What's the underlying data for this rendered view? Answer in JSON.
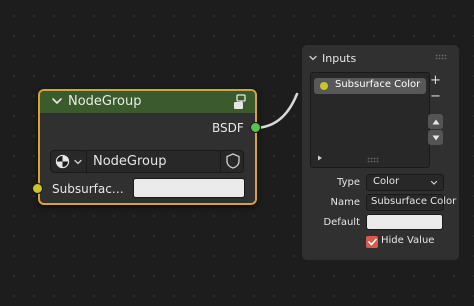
{
  "node": {
    "title": "NodeGroup",
    "output_socket": "BSDF",
    "group_name": "NodeGroup",
    "input_socket": "Subsurfac…",
    "header_color": "#3b5b2d",
    "selected_outline_color": "#d6a23a",
    "icons": {
      "collapse": "chevron-down-icon",
      "group": "node-group-icon",
      "browse": "node-tree-browse-icon",
      "fake_user": "shield-icon"
    }
  },
  "panel": {
    "title": "Inputs",
    "list": [
      {
        "label": "Subsurface Color",
        "socket_color": "#c7c729",
        "selected": true
      }
    ],
    "buttons": {
      "add": "+",
      "remove": "−"
    },
    "properties": {
      "type_label": "Type",
      "type_value": "Color",
      "name_label": "Name",
      "name_value": "Subsurface Color",
      "default_label": "Default",
      "default_color": "#ebebeb",
      "hide_value_label": "Hide Value",
      "hide_value_checked": true
    }
  },
  "colors": {
    "output_socket": "#57c24f",
    "color_socket": "#c7c729",
    "link": "#d9d9d9",
    "checkbox": "#d95a4a"
  }
}
